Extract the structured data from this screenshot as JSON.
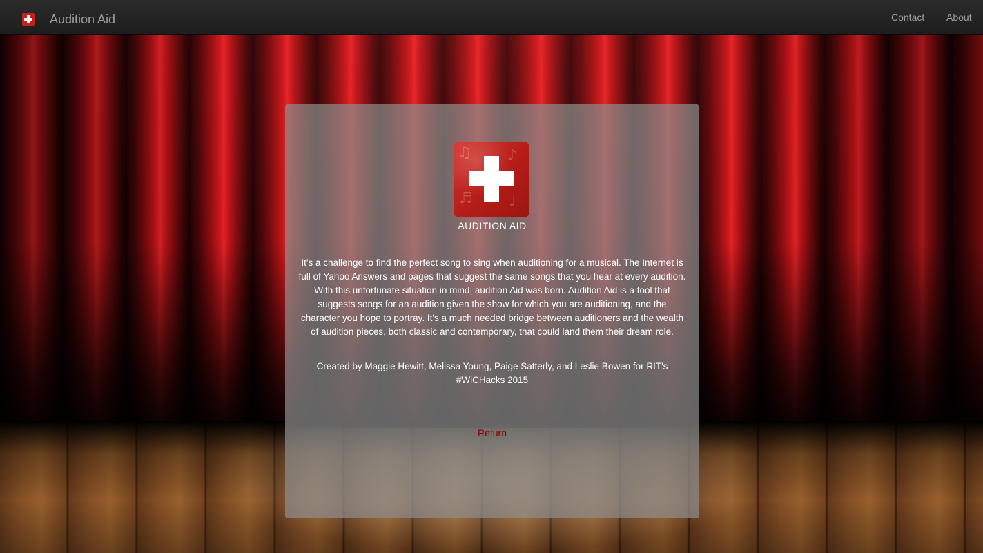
{
  "navbar": {
    "brand_title": "Audition Aid",
    "links": [
      {
        "label": "Contact"
      },
      {
        "label": "About"
      }
    ]
  },
  "panel": {
    "logo_caption": "AUDITION AID",
    "description": "It's a challenge to find the perfect song to sing when auditioning for a musical. The Internet is full of Yahoo Answers and pages that suggest the same songs that you hear at every audition. With this unfortunate situation in mind, audition Aid was born. Audition Aid is a tool that suggests songs for an audition given the show for which you are auditioning, and the character you hope to portray. It's a much needed bridge between auditioners and the wealth of audition pieces, both classic and contemporary, that could land them their dream role.",
    "credits": "Created by Maggie Hewitt, Melissa Young, Paige Satterly, and Leslie Bowen for RIT's #WiCHacks 2015",
    "return_label": "Return"
  },
  "colors": {
    "navbar_bg": "#222222",
    "nav_text": "#9d9d9d",
    "brand_red": "#c8201e",
    "return_link": "#8b0000",
    "panel_text": "#ffffff"
  },
  "icons": {
    "brand": "audition-aid-plus-icon",
    "logo": "audition-aid-logo"
  }
}
